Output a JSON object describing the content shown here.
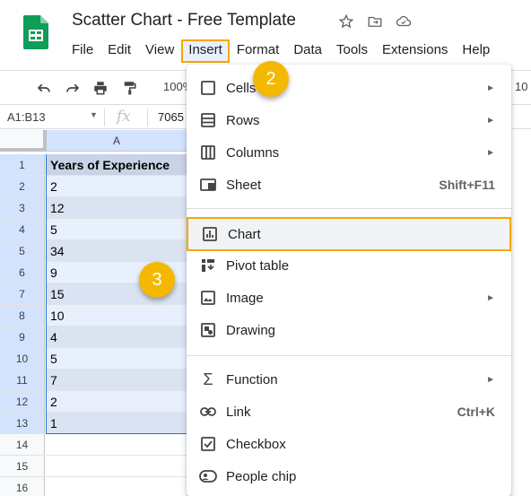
{
  "app": {
    "doc_title": "Scatter Chart - Free Template",
    "menu": [
      "File",
      "Edit",
      "View",
      "Insert",
      "Format",
      "Data",
      "Tools",
      "Extensions",
      "Help"
    ],
    "active_menu": "Insert"
  },
  "toolbar": {
    "zoom": "100%",
    "font_size_fragment": "10"
  },
  "formula_bar": {
    "name_box": "A1:B13",
    "fx": "fx",
    "value": "7065"
  },
  "sheet": {
    "column_header": "A",
    "row_numbers": [
      "1",
      "2",
      "3",
      "4",
      "5",
      "6",
      "7",
      "8",
      "9",
      "10",
      "11",
      "12",
      "13",
      "14",
      "15",
      "16"
    ],
    "column_a": [
      "Years of Experience",
      "2",
      "12",
      "5",
      "34",
      "9",
      "15",
      "10",
      "4",
      "5",
      "7",
      "2",
      "1",
      "",
      "",
      ""
    ]
  },
  "insert_menu": {
    "items": [
      {
        "label": "Cells",
        "icon": "cells-icon",
        "submenu": true
      },
      {
        "label": "Rows",
        "icon": "rows-icon",
        "submenu": true
      },
      {
        "label": "Columns",
        "icon": "columns-icon",
        "submenu": true
      },
      {
        "label": "Sheet",
        "icon": "sheet-icon",
        "shortcut": "Shift+F11"
      },
      {
        "label": "Chart",
        "icon": "chart-icon",
        "highlighted": true
      },
      {
        "label": "Pivot table",
        "icon": "pivot-table-icon"
      },
      {
        "label": "Image",
        "icon": "image-icon",
        "submenu": true
      },
      {
        "label": "Drawing",
        "icon": "drawing-icon"
      },
      {
        "label": "Function",
        "icon": "sigma-icon",
        "submenu": true
      },
      {
        "label": "Link",
        "icon": "link-icon",
        "shortcut": "Ctrl+K"
      },
      {
        "label": "Checkbox",
        "icon": "checkbox-icon"
      },
      {
        "label": "People chip",
        "icon": "people-chip-icon"
      }
    ]
  },
  "callouts": {
    "step_insert": "2",
    "step_chart": "3"
  },
  "colors": {
    "highlight_outline": "#f6a800",
    "callout": "#f5b800",
    "selection": "#1a73e8",
    "sheets_green": "#0f9d58"
  }
}
